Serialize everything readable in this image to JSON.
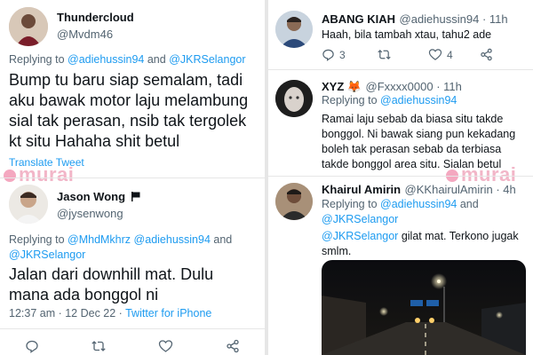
{
  "left": {
    "tweet1": {
      "name": "Thundercloud",
      "handle": "@Mvdm46",
      "replying_prefix": "Replying to ",
      "replying_to_1": "@adiehussin94",
      "replying_and": " and ",
      "replying_to_2": "@JKRSelangor",
      "text_lines": [
        "Bump tu baru siap semalam, tadi",
        "aku bawak motor laju melambung",
        "sial tak perasan, nsib tak tergolek",
        "kt situ Hahaha shit betul"
      ],
      "translate": "Translate Tweet"
    },
    "tweet2": {
      "name": "Jason Wong",
      "flag_icon": "black-flag-icon",
      "handle": "@jysenwong",
      "replying_prefix": "Replying to ",
      "replying_to_1": "@MhdMkhrz",
      "replying_to_2": "@adiehussin94",
      "replying_and": " and",
      "replying_to_3": "@JKRSelangor",
      "text_lines": [
        "Jalan dari downhill mat. Dulu",
        "mana ada bonggol ni"
      ],
      "time": "12:37 am · 12 Dec 22 · ",
      "source": "Twitter for iPhone"
    }
  },
  "right": {
    "tweet1": {
      "name": "ABANG KIAH",
      "handle": "@adiehussin94 · 11h",
      "text": "Haah, bila tambah xtau, tahu2 ade",
      "reply_count": "3",
      "like_count": "4"
    },
    "tweet2": {
      "name": "XYZ 🦊",
      "handle": "@Fxxxx0000 · 11h",
      "replying_prefix": "Replying to ",
      "replying_to": "@adiehussin94",
      "text_lines": [
        "Ramai laju sebab da biasa situ takde",
        "bonggol. Ni bawak siang pun kekadang",
        "boleh tak perasan sebab da terbiasa",
        "takde bonggol area situ. Sialan betul"
      ]
    },
    "tweet3": {
      "name": "Khairul Amirin",
      "handle": "@KKhairulAmirin · 4h",
      "replying_prefix": "Replying to ",
      "replying_to_1": "@adiehussin94",
      "replying_and": " and",
      "replying_to_2": "@JKRSelangor",
      "mention": "@JKRSelangor",
      "text_rest": " gilat mat. Terkono jugak",
      "text_line2": "smlm."
    }
  },
  "watermark": "murai",
  "colors": {
    "link": "#1d9bf0",
    "muted": "#536471",
    "text": "#0f1419",
    "watermark": "#f2b6c8"
  }
}
